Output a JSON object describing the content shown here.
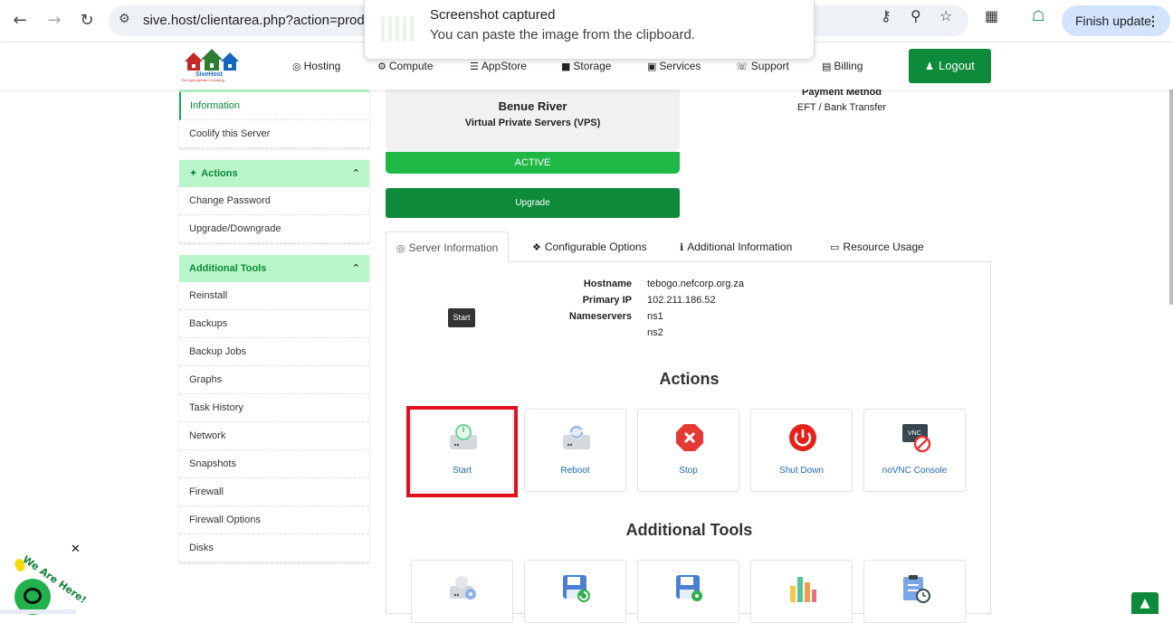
{
  "browser": {
    "url": "sive.host/clientarea.php?action=produc",
    "finish_update": "Finish update"
  },
  "toast": {
    "title": "Screenshot captured",
    "message": "You can paste the image from the clipboard."
  },
  "header": {
    "logo_text": "SiveHost",
    "logo_tagline": "The right partner in hosting.",
    "nav": [
      "Hosting",
      "Compute",
      "AppStore",
      "Storage",
      "Services",
      "Support",
      "Billing"
    ],
    "logout": "Logout"
  },
  "sidebar": {
    "top_items": [
      "Information",
      "Coolify this Server"
    ],
    "actions_title": "Actions",
    "actions_items": [
      "Change Password",
      "Upgrade/Downgrade"
    ],
    "tools_title": "Additional Tools",
    "tools_items": [
      "Reinstall",
      "Backups",
      "Backup Jobs",
      "Graphs",
      "Task History",
      "Network",
      "Snapshots",
      "Firewall",
      "Firewall Options",
      "Disks"
    ]
  },
  "product": {
    "name": "Benue River",
    "group": "Virtual Private Servers (VPS)",
    "status": "ACTIVE",
    "upgrade": "Upgrade",
    "payment_label": "Payment Method",
    "payment_value": "EFT / Bank Transfer"
  },
  "tabs": [
    "Server Information",
    "Configurable Options",
    "Additional Information",
    "Resource Usage"
  ],
  "server_info": {
    "hostname_label": "Hostname",
    "hostname": "tebogo.nefcorp.org.za",
    "ip_label": "Primary IP",
    "ip": "102.211.186.52",
    "ns_label": "Nameservers",
    "ns1": "ns1",
    "ns2": "ns2"
  },
  "tooltip": "Start",
  "actions_title": "Actions",
  "action_buttons": [
    "Start",
    "Reboot",
    "Stop",
    "Shut Down",
    "noVNC Console"
  ],
  "tools_title": "Additional Tools",
  "chat": {
    "label": "We Are Here!"
  },
  "colors": {
    "brand_green": "#0d8a3a",
    "status_green": "#1fb845",
    "highlight_red": "#e0101e",
    "link_blue": "#1e6ab0"
  }
}
